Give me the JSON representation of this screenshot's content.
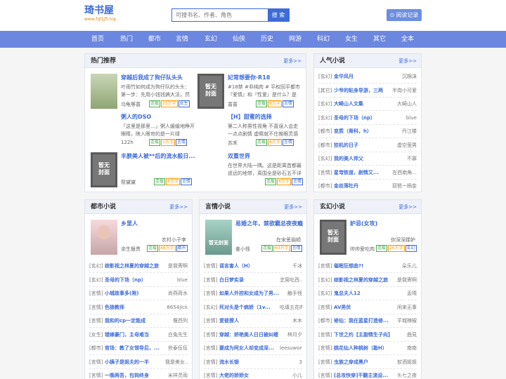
{
  "logo": {
    "title": "琦书屋",
    "url": "www.fqtljjft.top"
  },
  "search": {
    "placeholder": "可搜书名、作者、角色",
    "button": "搜 索"
  },
  "history_button": "阅读记录",
  "nav": [
    "首页",
    "热门",
    "都市",
    "言情",
    "玄幻",
    "仙侠",
    "历史",
    "网游",
    "科幻",
    "女生",
    "其它",
    "全本"
  ],
  "hot": {
    "title": "热门推荐",
    "more": "更多>>",
    "books": [
      {
        "title": "穿越后我成了狗仔队头头",
        "desc": "叶雨竹如何成为狗仔队的头头：第一步：先用小钱钱搞大法，然后",
        "author": "乌龟等蓑",
        "tags": [
          "连载",
          "25万字",
          "女生"
        ]
      },
      {
        "title": "妃常想要你·R18",
        "desc": "#18禁 #非纯肉 # 平权回平都市『爱情』和『性爱』是什么？是",
        "author": "蔷蔷",
        "tags": [
          "连载",
          "8万字",
          "言情"
        ]
      },
      {
        "title": "粥人的DSO",
        "desc": "「这里是那里…」粥人缓缓地睁开眼睛，映入眼帘的是一片绿",
        "author": "122h",
        "tags": [
          "连载",
          "1万字",
          "言情"
        ]
      },
      {
        "title": "【H】甜蜜的选择",
        "desc": "第二人称男性视角 不喜误入会走一点点剧情 虚睛就不住推眼灵感",
        "author": "苏禾",
        "tags": [
          "连载",
          "8万字",
          "言情"
        ]
      },
      {
        "title": "丰腴美人被**后的流水般日...",
        "desc": "",
        "author": "帮黛黛",
        "tags": [
          "连载",
          "4万字",
          "言情"
        ]
      },
      {
        "title": "双重世界",
        "desc": "在世界大陆一隅。这是距离首都最遥远的地带，周围全是砂石五不详",
        "author": "",
        "tags": [
          "连载",
          "6万字",
          "言情"
        ]
      }
    ]
  },
  "popular": {
    "title": "人气小说",
    "more": "更多>>",
    "items": [
      {
        "cat": "[玄幻]",
        "name": "金华风月",
        "author": "沉棉沫"
      },
      {
        "cat": "[其它]",
        "name": "少爷的贴身导游，三两",
        "author": "半岗小可爱"
      },
      {
        "cat": "[玄幻]",
        "name": "大崎山人文集",
        "author": "大崎山人"
      },
      {
        "cat": "[玄幻]",
        "name": "圣母的下场（np）",
        "author": "blue"
      },
      {
        "cat": "[都市]",
        "name": "变质（骨科，h）",
        "author": "丹江楼"
      },
      {
        "cat": "[都市]",
        "name": "狡机的日子",
        "author": "虚空萤男"
      },
      {
        "cat": "[玄幻]",
        "name": "我的美人师父",
        "author": "不寡"
      },
      {
        "cat": "[言情]",
        "name": "星穹铁道，剧情又...",
        "author": "在西南角..."
      },
      {
        "cat": "[都市]",
        "name": "金丝落牡丹",
        "author": "琵琶一柄金"
      }
    ]
  },
  "columns": [
    {
      "title": "都市小说",
      "more": "更多>>",
      "feature": {
        "title": "乡里人",
        "author_top": "农村小子李",
        "author": "余生狠贵",
        "tags": [
          "连载",
          "88万字",
          "都市"
        ]
      },
      "items": [
        {
          "cat": "[玄幻]",
          "name": "综影视之林夏的穿越之旅",
          "author": "是我寄啊"
        },
        {
          "cat": "[玄幻]",
          "name": "圣母的下场（np）",
          "author": "blue"
        },
        {
          "cat": "[言情]",
          "name": "小城故事多(限)",
          "author": "尚燕荷水"
        },
        {
          "cat": "[言情]",
          "name": "色狼教师",
          "author": "8654jlck"
        },
        {
          "cat": "[言情]",
          "name": "我和的cp一定能成",
          "author": "偃西列"
        },
        {
          "cat": "[女生]",
          "name": "错嫁豪门，主母难当",
          "author": "白兔先生"
        },
        {
          "cat": "[都市]",
          "name": "官场：教了女领导后，...",
          "author": "些泰伍伍"
        },
        {
          "cat": "[言情]",
          "name": "小姨子是姐夫的一半",
          "author": "我是美女..."
        },
        {
          "cat": "[言情]",
          "name": "一晚两吾，包钩终身",
          "author": "米祥灵雨"
        }
      ]
    },
    {
      "title": "言情小说",
      "more": "更多>>",
      "feature": {
        "title": "易婚之年，禁欲霸总夜夜瘾",
        "author_top": "在宋思瑜顺",
        "author": "姜小怪",
        "tags": [
          "连载",
          "63万字",
          "言情"
        ]
      },
      "items": [
        {
          "cat": "[言情]",
          "name": "谣言害人（H）",
          "author": "千冰"
        },
        {
          "cat": "[言情]",
          "name": "白日梦实录",
          "author": "芝窝吃西..."
        },
        {
          "cat": "[言情]",
          "name": "如果人外控和女成为了男...",
          "author": "触手怪"
        },
        {
          "cat": "[玄幻]",
          "name": "死对头是个病娇（1v...",
          "author": "吃填五花肉"
        },
        {
          "cat": "[言情]",
          "name": "爱彼撩人",
          "author": "木木"
        },
        {
          "cat": "[言情]",
          "name": "穿越：娇艳美人日日被纠缠",
          "author": "林月夕"
        },
        {
          "cat": "[言情]",
          "name": "要成为阿女人却变成深...",
          "author": "leesuwon"
        },
        {
          "cat": "[言情]",
          "name": "流水长银",
          "author": "3"
        },
        {
          "cat": "[言情]",
          "name": "大佬的娇娇女",
          "author": "小儿"
        }
      ]
    },
    {
      "title": "玄幻小说",
      "more": "更多>>",
      "feature": {
        "title": "妒忌(女攻)",
        "author_top": "你深深蹂妒",
        "author": "帅帅爱吃肉",
        "tags": [
          "连载",
          "26万字",
          "玄幻"
        ]
      },
      "items": [
        {
          "cat": "[言情]",
          "name": "催眠狂想曲?!",
          "author": "朵乐儿"
        },
        {
          "cat": "[玄幻]",
          "name": "综影视之林夏的穿越之旅",
          "author": "是我寄啊"
        },
        {
          "cat": "[玄幻]",
          "name": "鬼总夫人12",
          "author": "孟晴"
        },
        {
          "cat": "[言情]",
          "name": "AV男优",
          "author": "闲来无事"
        },
        {
          "cat": "[都市]",
          "name": "修仙：我在蓝星打造修...",
          "author": "平城辣椒"
        },
        {
          "cat": "[言情]",
          "name": "下世之约【主副情生子向】",
          "author": "曲見"
        },
        {
          "cat": "[言情]",
          "name": "桃花仙人种桃树（勘H）",
          "author": "南南"
        },
        {
          "cat": "[言情]",
          "name": "虫族之穿成黑户",
          "author": "软洒姐姐"
        },
        {
          "cat": "[言情]",
          "name": "[总攻快穿]干翻主流设...",
          "author": "头七之夜"
        }
      ]
    }
  ],
  "colors": {
    "primary": "#3d6bd8",
    "nav": "#6b87e0",
    "accent": "#e58a12"
  }
}
